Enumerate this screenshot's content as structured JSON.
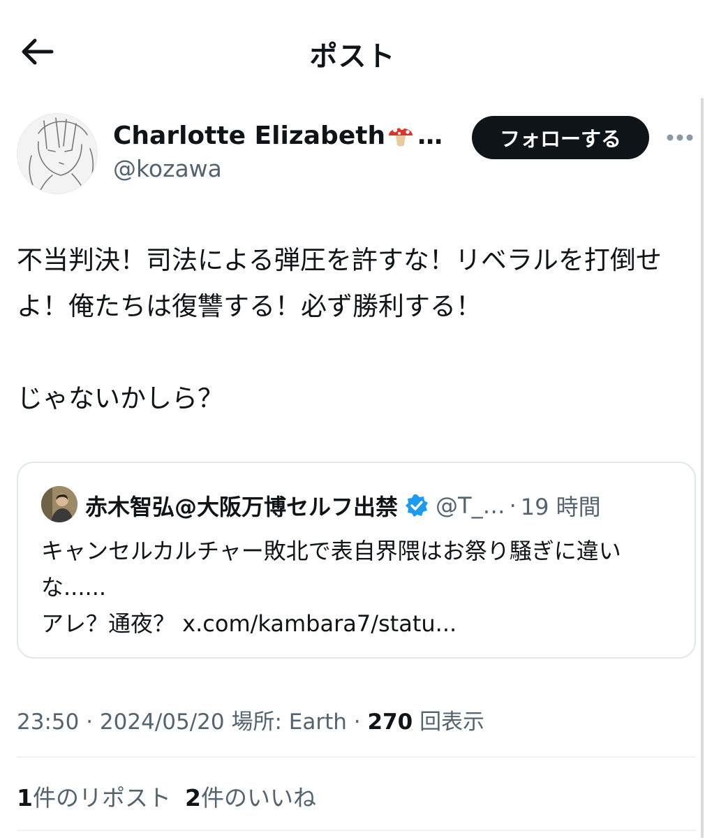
{
  "header": {
    "title": "ポスト"
  },
  "author": {
    "display_name": "Charlotte Elizabeth",
    "display_name_suffix": "…",
    "handle": "@kozawa"
  },
  "follow_label": "フォローする",
  "post_text": "不当判決！司法による弾圧を許すな！リベラルを打倒せよ！俺たちは復讐する！必ず勝利する！\n\nじゃないかしら？",
  "quote": {
    "display_name": "赤木智弘@大阪万博セルフ出禁",
    "handle": "@T_…",
    "separator": "·",
    "time": "19 時間",
    "text": "キャンセルカルチャー敗北で表自界隈はお祭り騒ぎに違いな......\nアレ？通夜？ x.com/kambara7/statu..."
  },
  "meta": {
    "time": "23:50",
    "dot": "·",
    "date": "2024/05/20",
    "location": "場所: Earth",
    "views": "270",
    "views_label": "回表示"
  },
  "stats": {
    "reposts_count": "1",
    "reposts_label": "件のリポスト",
    "likes_count": "2",
    "likes_label": "件のいいね"
  },
  "colors": {
    "text": "#0f1419",
    "secondary": "#536471",
    "verified": "#1d9bf0",
    "border": "#e1e8ed"
  },
  "icons": [
    "arrow-left-icon",
    "more-icon",
    "mushroom-emoji",
    "verified-badge-icon"
  ]
}
